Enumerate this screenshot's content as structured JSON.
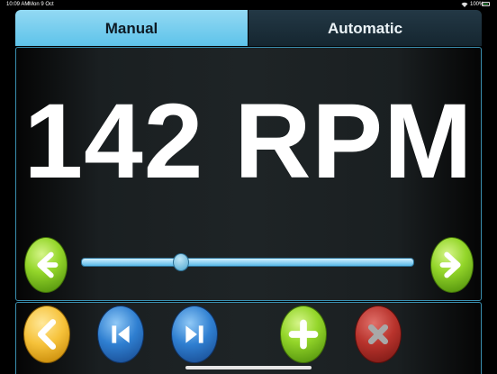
{
  "status": {
    "time": "10:09 AM",
    "date": "Mon 9 Oct",
    "battery": "100%"
  },
  "tabs": [
    {
      "label": "Manual",
      "selected": true
    },
    {
      "label": "Automatic",
      "selected": false
    }
  ],
  "display": {
    "rpm_text": "142 RPM"
  },
  "slider": {
    "fraction": 0.3
  },
  "colors": {
    "accent": "#5ec3ea",
    "green": "#94d62a",
    "gold": "#f6c23a",
    "blue": "#2f7fd1",
    "red": "#b8332c"
  },
  "icons": {
    "decrease": "arrow-left-icon",
    "increase": "arrow-right-icon",
    "back": "chevron-left-icon",
    "skip_back": "skip-back-icon",
    "skip_forward": "skip-forward-icon",
    "add": "plus-icon",
    "close": "close-icon"
  }
}
